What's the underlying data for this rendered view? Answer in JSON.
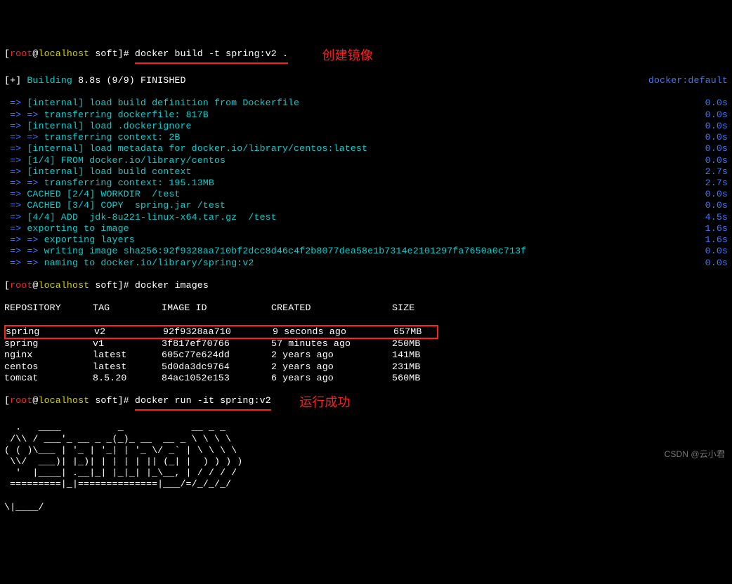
{
  "prompt": {
    "user": "root",
    "host": "localhost",
    "cwd": "soft",
    "cmd_build": "docker build -t spring:v2 .",
    "cmd_images": "docker images",
    "cmd_run": "docker run -it spring:v2"
  },
  "anno": {
    "build": "创建镜像",
    "run": "运行成功"
  },
  "build_header": {
    "prefix": "[+]",
    "label": "Building",
    "timing": "8.8s (9/9) FINISHED",
    "backend": "docker:default"
  },
  "steps": [
    {
      "arrow": "=>",
      "sub": "",
      "text": "[internal] load build definition from Dockerfile",
      "time": "0.0s"
    },
    {
      "arrow": "=>",
      "sub": "=> ",
      "text": "transferring dockerfile: 817B",
      "time": "0.0s"
    },
    {
      "arrow": "=>",
      "sub": "",
      "text": "[internal] load .dockerignore",
      "time": "0.0s"
    },
    {
      "arrow": "=>",
      "sub": "=> ",
      "text": "transferring context: 2B",
      "time": "0.0s"
    },
    {
      "arrow": "=>",
      "sub": "",
      "text": "[internal] load metadata for docker.io/library/centos:latest",
      "time": "0.0s"
    },
    {
      "arrow": "=>",
      "sub": "",
      "text": "[1/4] FROM docker.io/library/centos",
      "time": "0.0s"
    },
    {
      "arrow": "=>",
      "sub": "",
      "text": "[internal] load build context",
      "time": "2.7s"
    },
    {
      "arrow": "=>",
      "sub": "=> ",
      "text": "transferring context: 195.13MB",
      "time": "2.7s"
    },
    {
      "arrow": "=>",
      "sub": "",
      "text": "CACHED [2/4] WORKDIR  /test",
      "time": "0.0s"
    },
    {
      "arrow": "=>",
      "sub": "",
      "text": "CACHED [3/4] COPY  spring.jar /test",
      "time": "0.0s"
    },
    {
      "arrow": "=>",
      "sub": "",
      "text": "[4/4] ADD  jdk-8u221-linux-x64.tar.gz  /test",
      "time": "4.5s"
    },
    {
      "arrow": "=>",
      "sub": "",
      "text": "exporting to image",
      "time": "1.6s"
    },
    {
      "arrow": "=>",
      "sub": "=> ",
      "text": "exporting layers",
      "time": "1.6s"
    },
    {
      "arrow": "=>",
      "sub": "=> ",
      "text": "writing image sha256:92f9328aa710bf2dcc8d46c4f2b8077dea58e1b7314e2101297fa7650a0c713f",
      "time": "0.0s"
    },
    {
      "arrow": "=>",
      "sub": "=> ",
      "text": "naming to docker.io/library/spring:v2",
      "time": "0.0s"
    }
  ],
  "table": {
    "headers": {
      "repo": "REPOSITORY",
      "tag": "TAG",
      "img": "IMAGE ID",
      "cre": "CREATED",
      "size": "SIZE"
    },
    "rows": [
      {
        "repo": "spring",
        "tag": "v2",
        "img": "92f9328aa710",
        "cre": "9 seconds ago",
        "size": "657MB",
        "highlight": true
      },
      {
        "repo": "spring",
        "tag": "v1",
        "img": "3f817ef70766",
        "cre": "57 minutes ago",
        "size": "250MB"
      },
      {
        "repo": "nginx",
        "tag": "latest",
        "img": "605c77e624dd",
        "cre": "2 years ago",
        "size": "141MB"
      },
      {
        "repo": "centos",
        "tag": "latest",
        "img": "5d0da3dc9764",
        "cre": "2 years ago",
        "size": "231MB"
      },
      {
        "repo": "tomcat",
        "tag": "8.5.20",
        "img": "84ac1052e153",
        "cre": "6 years ago",
        "size": "560MB"
      }
    ]
  },
  "ascii": [
    "  .   ____          _            __ _ _",
    " /\\\\ / ___'_ __ _ _(_)_ __  __ _ \\ \\ \\ \\",
    "( ( )\\___ | '_ | '_| | '_ \\/ _` | \\ \\ \\ \\",
    " \\\\/  ___)| |_)| | | | | || (_| |  ) ) ) )",
    "  '  |____| .__|_| |_|_| |_\\__, | / / / /",
    " =========|_|==============|___/=/_/_/_/"
  ],
  "watermark": "CSDN @云小君"
}
